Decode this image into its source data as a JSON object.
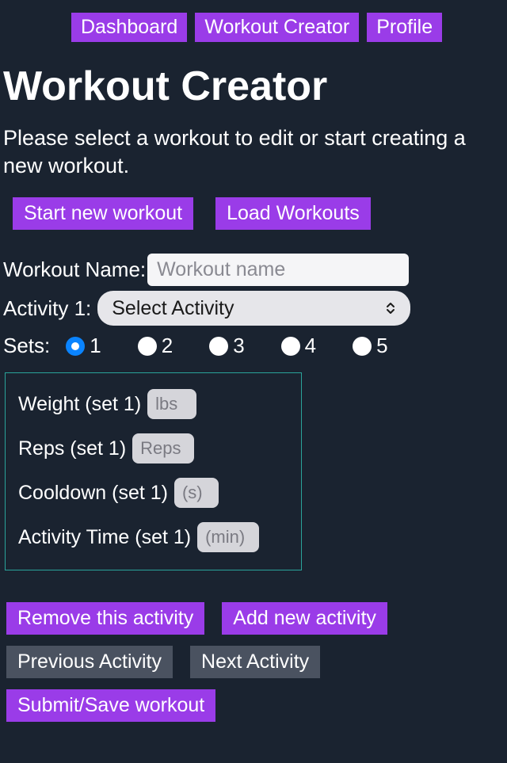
{
  "nav": {
    "dashboard": "Dashboard",
    "workout_creator": "Workout Creator",
    "profile": "Profile"
  },
  "page": {
    "title": "Workout Creator",
    "subtitle": "Please select a workout to edit or start creating a new workout."
  },
  "buttons": {
    "start_new": "Start new workout",
    "load": "Load Workouts",
    "remove_activity": "Remove this activity",
    "add_activity": "Add new activity",
    "prev_activity": "Previous Activity",
    "next_activity": "Next Activity",
    "submit": "Submit/Save workout"
  },
  "form": {
    "workout_name_label": "Workout Name:",
    "workout_name_placeholder": "Workout name",
    "activity_label": "Activity 1:",
    "activity_select_placeholder": "Select Activity",
    "sets_label": "Sets:",
    "sets_options": [
      "1",
      "2",
      "3",
      "4",
      "5"
    ],
    "sets_selected": "1"
  },
  "set1": {
    "weight_label": "Weight (set 1)",
    "weight_placeholder": "lbs",
    "reps_label": "Reps (set 1)",
    "reps_placeholder": "Reps",
    "cooldown_label": "Cooldown (set 1)",
    "cooldown_placeholder": "(s)",
    "time_label": "Activity Time (set 1)",
    "time_placeholder": "(min)"
  }
}
